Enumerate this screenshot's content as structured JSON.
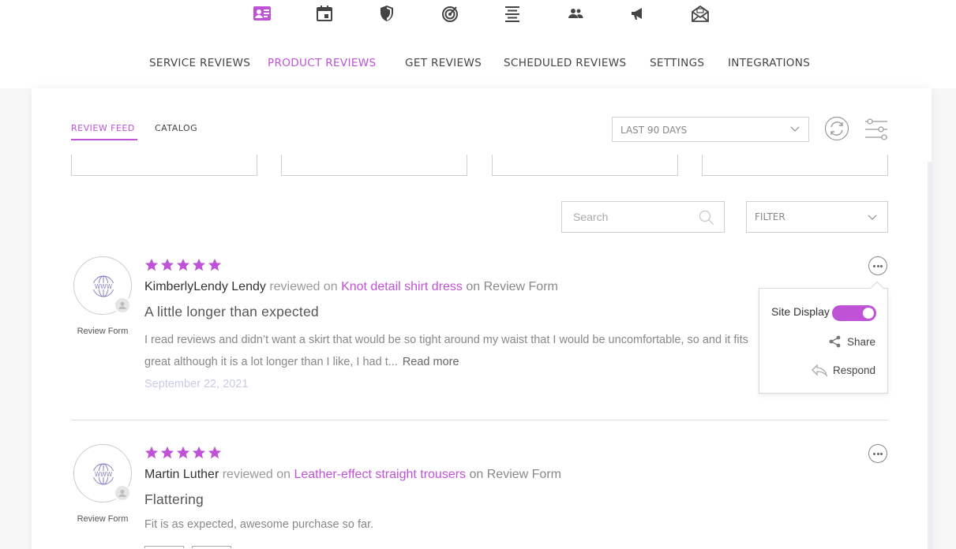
{
  "topbar": {
    "icons": [
      {
        "name": "reviews-icon",
        "active": true
      },
      {
        "name": "calendar-icon",
        "active": false
      },
      {
        "name": "shield-icon",
        "active": false
      },
      {
        "name": "target-icon",
        "active": false
      },
      {
        "name": "align-center-icon",
        "active": false
      },
      {
        "name": "people-icon",
        "active": false
      },
      {
        "name": "megaphone-icon",
        "active": false
      },
      {
        "name": "mail-open-icon",
        "active": false
      }
    ],
    "active_color": "#c052d8"
  },
  "nav": {
    "items": [
      {
        "label": "SERVICE REVIEWS"
      },
      {
        "label": "PRODUCT REVIEWS"
      },
      {
        "label": "GET REVIEWS"
      },
      {
        "label": "SCHEDULED REVIEWS"
      },
      {
        "label": "SETTINGS"
      },
      {
        "label": "INTEGRATIONS"
      }
    ],
    "active_index": 1
  },
  "subtabs": {
    "items": [
      {
        "label": "REVIEW FEED"
      },
      {
        "label": "CATALOG"
      }
    ],
    "active_index": 0
  },
  "toolbar": {
    "date_range": "LAST 90 DAYS",
    "search_placeholder": "Search",
    "filter_label": "FILTER"
  },
  "reviews": [
    {
      "source": "Review Form",
      "rating": 5,
      "reviewer": "KimberlyLendy Lendy",
      "verb": "reviewed on",
      "product": "Knot detail shirt dress",
      "on_form": "on Review Form",
      "title": "A little longer than expected",
      "body": "I read reviews and didn’t want a skirt that would be so tight around my waist that I would be uncomfortable, so and it fits great although it is a lot longer than I like, I had t...",
      "read_more": "Read more",
      "date": "September 22, 2021"
    },
    {
      "source": "Review Form",
      "rating": 5,
      "reviewer": "Martin Luther",
      "verb": "reviewed on",
      "product": "Leather-effect straight trousers",
      "on_form": "on Review Form",
      "title": "Flattering",
      "body": "Fit is as expected, awesome purchase so far."
    }
  ],
  "popover": {
    "site_display_label": "Site Display",
    "site_display_on": true,
    "share_label": "Share",
    "respond_label": "Respond"
  },
  "colors": {
    "accent": "#c052d8",
    "date": "#c9cbe6",
    "star": "#c052d8"
  }
}
